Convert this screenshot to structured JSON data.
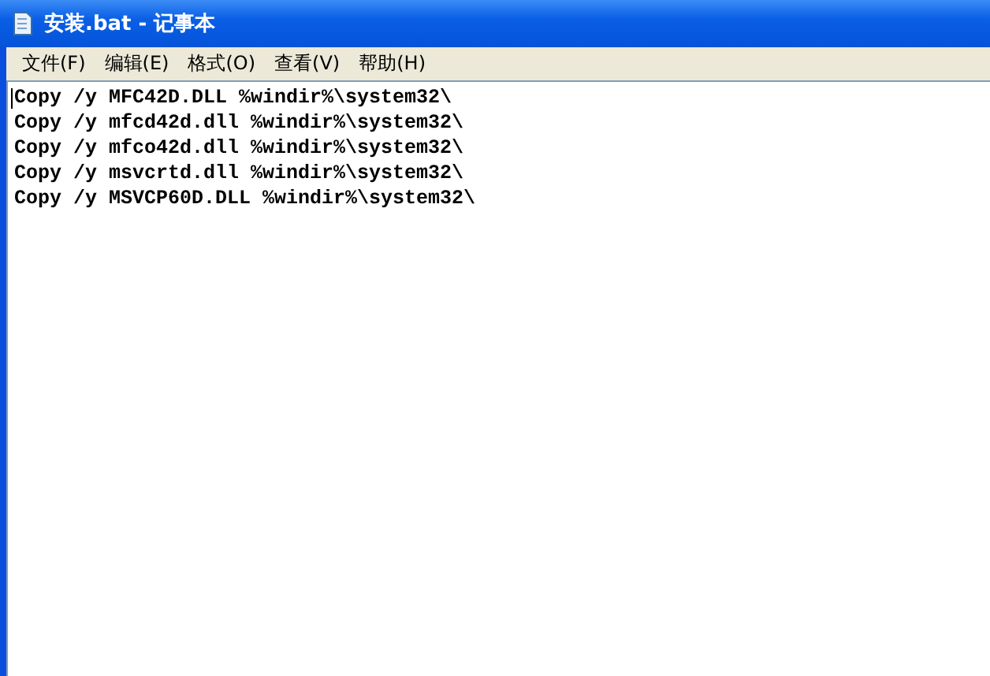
{
  "window": {
    "title": "安装.bat - 记事本"
  },
  "menu": [
    {
      "label": "文件(F)"
    },
    {
      "label": "编辑(E)"
    },
    {
      "label": "格式(O)"
    },
    {
      "label": "查看(V)"
    },
    {
      "label": "帮助(H)"
    }
  ],
  "editor": {
    "lines": [
      "Copy /y MFC42D.DLL %windir%\\system32\\",
      "Copy /y mfcd42d.dll %windir%\\system32\\",
      "Copy /y mfco42d.dll %windir%\\system32\\",
      "Copy /y msvcrtd.dll %windir%\\system32\\",
      "Copy /y MSVCP60D.DLL %windir%\\system32\\"
    ]
  }
}
